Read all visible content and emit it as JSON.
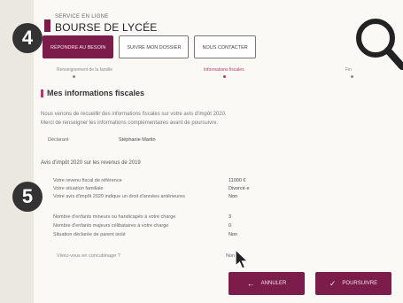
{
  "header": {
    "brand_small": "SERVICE EN LIGNE",
    "brand_title": "BOURSE DE LYCÉE"
  },
  "tabs": [
    {
      "label": "RÉPONDRE AU BESOIN"
    },
    {
      "label": "SUIVRE MON DOSSIER"
    },
    {
      "label": "NOUS CONTACTER"
    }
  ],
  "steps": [
    {
      "label": "Renseignement de la famille"
    },
    {
      "label": "Informations fiscales"
    },
    {
      "label": "Fin"
    }
  ],
  "section": {
    "title": "Mes informations fiscales",
    "intro_1": "Nous venons de recueillir des informations fiscales sur votre avis d'impôt 2020.",
    "intro_2": "Merci de renseigner les informations complémentaires avant de poursuivre."
  },
  "declarant": {
    "label": "Déclarant",
    "value": "Stéphanie Martin"
  },
  "avis_heading": "Avis d'impôt 2020 sur les revenus de 2019",
  "fiscal_rows": [
    {
      "label": "Votre revenu fiscal de référence",
      "value": "11000 €"
    },
    {
      "label": "Votre situation familiale",
      "value": "Divorcé·e"
    },
    {
      "label": "Votre avis d'impôt 2020 indique un droit d'années antérieures",
      "value": "Non"
    }
  ],
  "extra_rows": [
    {
      "label": "Nombre d'enfants mineurs ou handicapés à votre charge",
      "value": "3"
    },
    {
      "label": "Nombre d'enfants majeurs célibataires à votre charge",
      "value": "0"
    },
    {
      "label": "Situation déclarée de parent isolé",
      "value": "Non"
    }
  ],
  "concubinage": {
    "label": "Vivez-vous en concubinage ?",
    "value": "Non"
  },
  "buttons": {
    "cancel": "ANNULER",
    "next": "POURSUIVRE"
  },
  "badges": {
    "top": "4",
    "mid": "5"
  },
  "icons": {
    "badge_4": "step-4-badge",
    "badge_5": "step-5-badge",
    "magnifier": "magnifier-icon",
    "cursor": "mouse-pointer-icon",
    "cancel": "arrow-left-icon",
    "next": "check-icon"
  },
  "colors": {
    "brand": "#7b1c4a",
    "accent": "#b53a6b",
    "badge": "#333333"
  }
}
